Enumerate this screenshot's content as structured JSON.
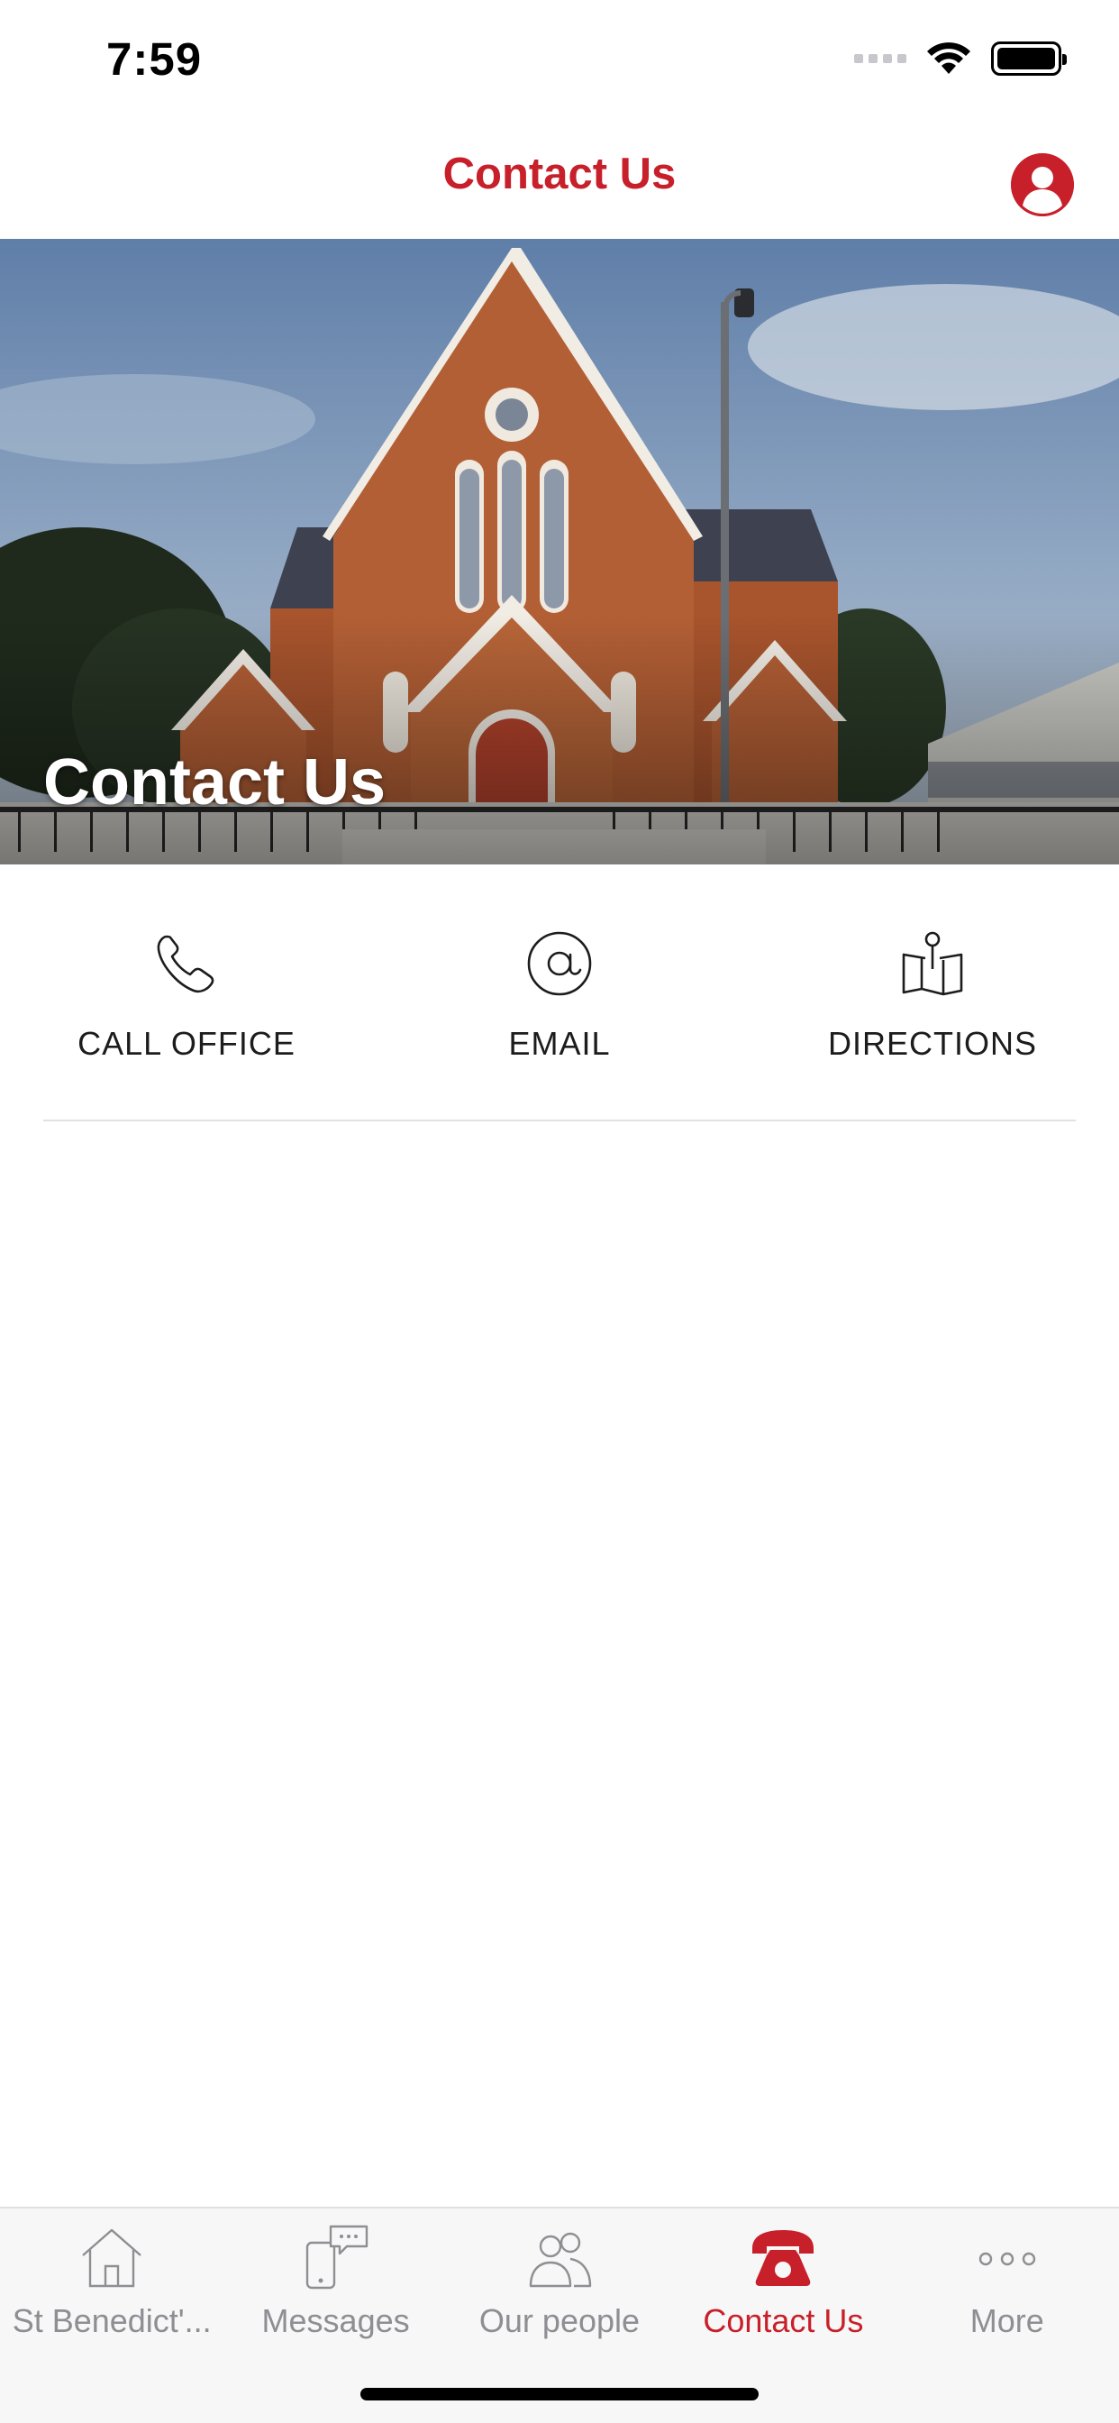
{
  "status_bar": {
    "time": "7:59"
  },
  "nav": {
    "title": "Contact Us"
  },
  "hero": {
    "title": "Contact Us"
  },
  "actions": [
    {
      "label": "CALL OFFICE",
      "icon": "phone-icon"
    },
    {
      "label": "EMAIL",
      "icon": "at-icon"
    },
    {
      "label": "DIRECTIONS",
      "icon": "map-icon"
    }
  ],
  "tabs": [
    {
      "label": "St Benedict'...",
      "icon": "home-icon",
      "active": false
    },
    {
      "label": "Messages",
      "icon": "messages-icon",
      "active": false
    },
    {
      "label": "Our people",
      "icon": "people-icon",
      "active": false
    },
    {
      "label": "Contact Us",
      "icon": "telephone-icon",
      "active": true
    },
    {
      "label": "More",
      "icon": "more-icon",
      "active": false
    }
  ],
  "colors": {
    "accent": "#c8202a",
    "inactive": "#8e8e93",
    "tab_bg": "#f7f7f7"
  }
}
